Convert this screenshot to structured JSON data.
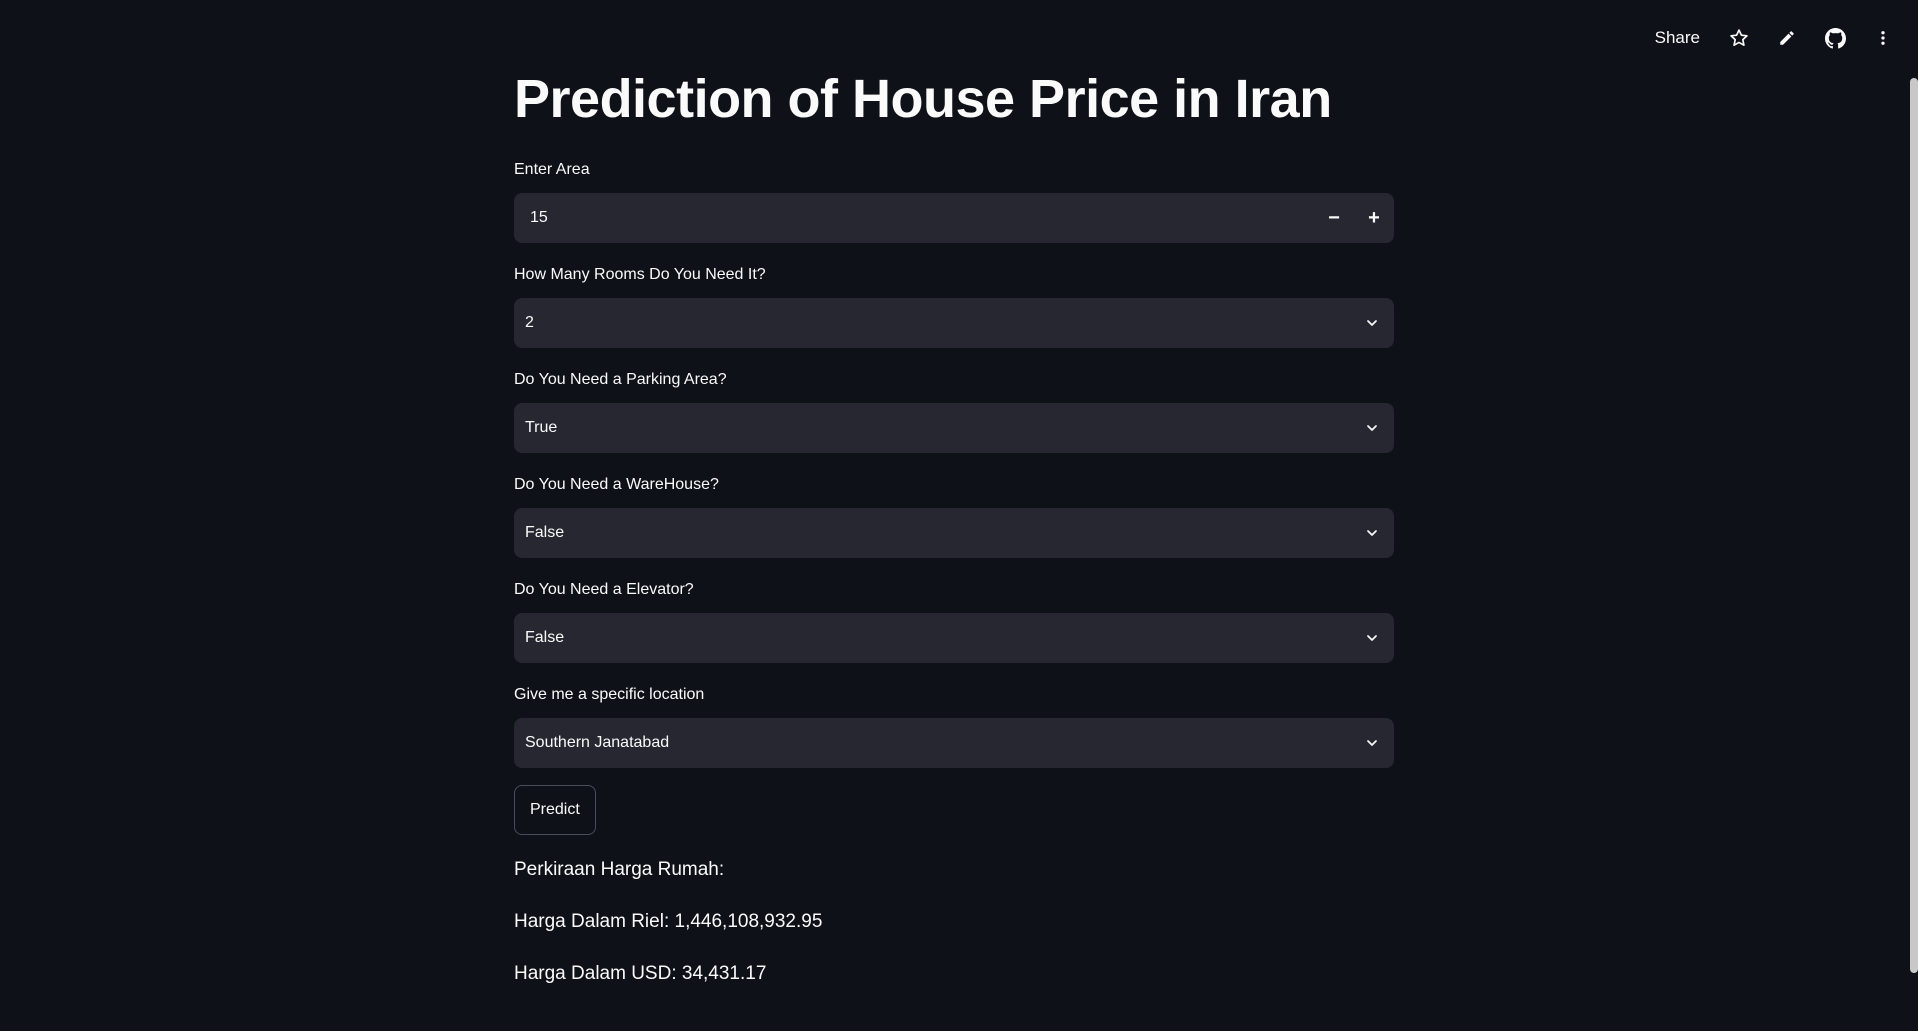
{
  "toolbar": {
    "share_label": "Share",
    "icons": [
      "star-icon",
      "pencil-icon",
      "github-icon",
      "more-vertical-icon"
    ]
  },
  "page": {
    "title": "Prediction of House Price in Iran"
  },
  "form": {
    "area": {
      "label": "Enter Area",
      "value": "15",
      "minus": "−",
      "plus": "+"
    },
    "rooms": {
      "label": "How Many Rooms Do You Need It?",
      "value": "2"
    },
    "parking": {
      "label": "Do You Need a Parking Area?",
      "value": "True"
    },
    "warehouse": {
      "label": "Do You Need a WareHouse?",
      "value": "False"
    },
    "elevator": {
      "label": "Do You Need a Elevator?",
      "value": "False"
    },
    "location": {
      "label": "Give me a specific location",
      "value": "Southern Janatabad"
    },
    "predict_label": "Predict"
  },
  "result": {
    "heading": "Perkiraan Harga Rumah:",
    "riel": "Harga Dalam Riel: 1,446,108,932.95",
    "usd": "Harga Dalam USD: 34,431.17"
  },
  "colors": {
    "background": "#0e1117",
    "input_bg": "#262730",
    "text": "#fafafa"
  }
}
